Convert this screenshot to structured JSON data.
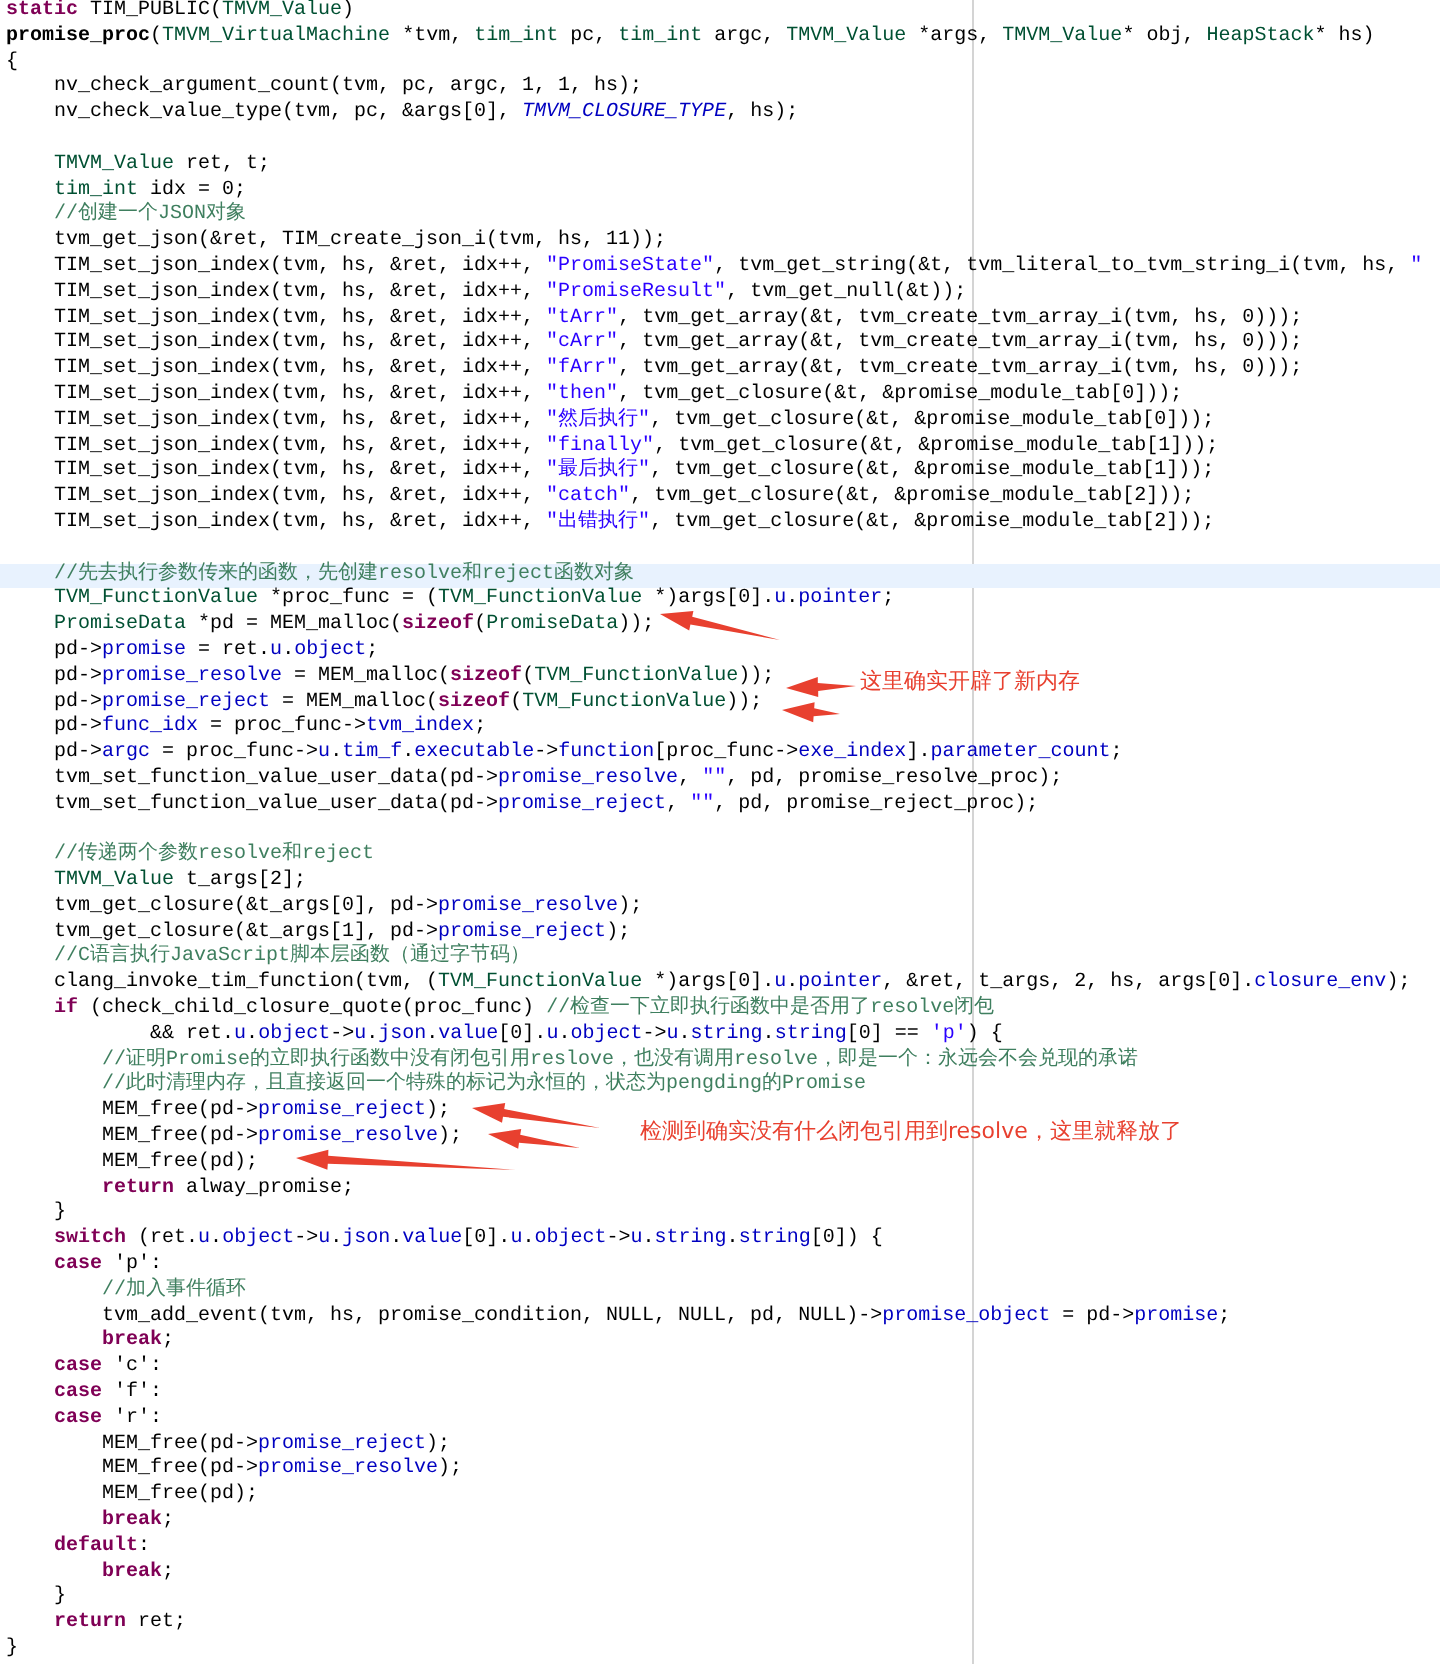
{
  "lines": [
    {
      "kind": "code",
      "current": false,
      "tokens": [
        {
          "kind": "keyword",
          "text": "static"
        },
        {
          "kind": "plain",
          "text": " TIM_PUBLIC("
        },
        {
          "kind": "type",
          "text": "TMVM_Value"
        },
        {
          "kind": "plain",
          "text": ")"
        }
      ]
    },
    {
      "kind": "code",
      "current": false,
      "tokens": [
        {
          "kind": "definition",
          "text": "promise_proc"
        },
        {
          "kind": "plain",
          "text": "("
        },
        {
          "kind": "type",
          "text": "TMVM_VirtualMachine"
        },
        {
          "kind": "plain",
          "text": " *tvm, "
        },
        {
          "kind": "type",
          "text": "tim_int"
        },
        {
          "kind": "plain",
          "text": " pc, "
        },
        {
          "kind": "type",
          "text": "tim_int"
        },
        {
          "kind": "plain",
          "text": " argc, "
        },
        {
          "kind": "type",
          "text": "TMVM_Value"
        },
        {
          "kind": "plain",
          "text": " *args, "
        },
        {
          "kind": "type",
          "text": "TMVM_Value"
        },
        {
          "kind": "plain",
          "text": "* obj, "
        },
        {
          "kind": "type",
          "text": "HeapStack"
        },
        {
          "kind": "plain",
          "text": "* hs)"
        }
      ]
    },
    {
      "kind": "code",
      "current": false,
      "tokens": [
        {
          "kind": "plain",
          "text": "{"
        }
      ]
    },
    {
      "kind": "code",
      "current": false,
      "tokens": [
        {
          "kind": "plain",
          "text": "    nv_check_argument_count(tvm, pc, argc, 1, 1, hs);"
        }
      ]
    },
    {
      "kind": "code",
      "current": false,
      "tokens": [
        {
          "kind": "plain",
          "text": "    nv_check_value_type(tvm, pc, &args[0], "
        },
        {
          "kind": "constant",
          "text": "TMVM_CLOSURE_TYPE"
        },
        {
          "kind": "plain",
          "text": ", hs);"
        }
      ]
    },
    {
      "kind": "blank",
      "current": false
    },
    {
      "kind": "code",
      "current": false,
      "tokens": [
        {
          "kind": "type",
          "text": "    TMVM_Value"
        },
        {
          "kind": "plain",
          "text": " ret, t;"
        }
      ]
    },
    {
      "kind": "code",
      "current": false,
      "tokens": [
        {
          "kind": "type",
          "text": "    tim_int"
        },
        {
          "kind": "plain",
          "text": " idx = 0;"
        }
      ]
    },
    {
      "kind": "code",
      "current": false,
      "tokens": [
        {
          "kind": "comment",
          "text": "    //创建一个JSON对象"
        }
      ]
    },
    {
      "kind": "code",
      "current": false,
      "tokens": [
        {
          "kind": "plain",
          "text": "    tvm_get_json(&ret, TIM_create_json_i(tvm, hs, 11));"
        }
      ]
    },
    {
      "kind": "code",
      "current": false,
      "tokens": [
        {
          "kind": "plain",
          "text": "    TIM_set_json_index(tvm, hs, &ret, idx++, "
        },
        {
          "kind": "string",
          "text": "\"PromiseState\""
        },
        {
          "kind": "plain",
          "text": ", tvm_get_string(&t, tvm_literal_to_tvm_string_i(tvm, hs, "
        },
        {
          "kind": "string",
          "text": "\""
        }
      ]
    },
    {
      "kind": "code",
      "current": false,
      "tokens": [
        {
          "kind": "plain",
          "text": "    TIM_set_json_index(tvm, hs, &ret, idx++, "
        },
        {
          "kind": "string",
          "text": "\"PromiseResult\""
        },
        {
          "kind": "plain",
          "text": ", tvm_get_null(&t));"
        }
      ]
    },
    {
      "kind": "code",
      "current": false,
      "tokens": [
        {
          "kind": "plain",
          "text": "    TIM_set_json_index(tvm, hs, &ret, idx++, "
        },
        {
          "kind": "string",
          "text": "\"tArr\""
        },
        {
          "kind": "plain",
          "text": ", tvm_get_array(&t, tvm_create_tvm_array_i(tvm, hs, 0)));"
        }
      ]
    },
    {
      "kind": "code",
      "current": false,
      "tokens": [
        {
          "kind": "plain",
          "text": "    TIM_set_json_index(tvm, hs, &ret, idx++, "
        },
        {
          "kind": "string",
          "text": "\"cArr\""
        },
        {
          "kind": "plain",
          "text": ", tvm_get_array(&t, tvm_create_tvm_array_i(tvm, hs, 0)));"
        }
      ]
    },
    {
      "kind": "code",
      "current": false,
      "tokens": [
        {
          "kind": "plain",
          "text": "    TIM_set_json_index(tvm, hs, &ret, idx++, "
        },
        {
          "kind": "string",
          "text": "\"fArr\""
        },
        {
          "kind": "plain",
          "text": ", tvm_get_array(&t, tvm_create_tvm_array_i(tvm, hs, 0)));"
        }
      ]
    },
    {
      "kind": "code",
      "current": false,
      "tokens": [
        {
          "kind": "plain",
          "text": "    TIM_set_json_index(tvm, hs, &ret, idx++, "
        },
        {
          "kind": "string",
          "text": "\"then\""
        },
        {
          "kind": "plain",
          "text": ", tvm_get_closure(&t, &promise_module_tab[0]));"
        }
      ]
    },
    {
      "kind": "code",
      "current": false,
      "tokens": [
        {
          "kind": "plain",
          "text": "    TIM_set_json_index(tvm, hs, &ret, idx++, "
        },
        {
          "kind": "string",
          "text": "\"然后执行\""
        },
        {
          "kind": "plain",
          "text": ", tvm_get_closure(&t, &promise_module_tab[0]));"
        }
      ]
    },
    {
      "kind": "code",
      "current": false,
      "tokens": [
        {
          "kind": "plain",
          "text": "    TIM_set_json_index(tvm, hs, &ret, idx++, "
        },
        {
          "kind": "string",
          "text": "\"finally\""
        },
        {
          "kind": "plain",
          "text": ", tvm_get_closure(&t, &promise_module_tab[1]));"
        }
      ]
    },
    {
      "kind": "code",
      "current": false,
      "tokens": [
        {
          "kind": "plain",
          "text": "    TIM_set_json_index(tvm, hs, &ret, idx++, "
        },
        {
          "kind": "string",
          "text": "\"最后执行\""
        },
        {
          "kind": "plain",
          "text": ", tvm_get_closure(&t, &promise_module_tab[1]));"
        }
      ]
    },
    {
      "kind": "code",
      "current": false,
      "tokens": [
        {
          "kind": "plain",
          "text": "    TIM_set_json_index(tvm, hs, &ret, idx++, "
        },
        {
          "kind": "string",
          "text": "\"catch\""
        },
        {
          "kind": "plain",
          "text": ", tvm_get_closure(&t, &promise_module_tab[2]));"
        }
      ]
    },
    {
      "kind": "code",
      "current": false,
      "tokens": [
        {
          "kind": "plain",
          "text": "    TIM_set_json_index(tvm, hs, &ret, idx++, "
        },
        {
          "kind": "string",
          "text": "\"出错执行\""
        },
        {
          "kind": "plain",
          "text": ", tvm_get_closure(&t, &promise_module_tab[2]));"
        }
      ]
    },
    {
      "kind": "blank",
      "current": false
    },
    {
      "kind": "code",
      "current": true,
      "tokens": [
        {
          "kind": "comment",
          "text": "    //先去执行参数传来的函数，先创建resolve和reject函数对象"
        }
      ]
    },
    {
      "kind": "code",
      "current": false,
      "tokens": [
        {
          "kind": "type",
          "text": "    TVM_FunctionValue"
        },
        {
          "kind": "plain",
          "text": " *proc_func = ("
        },
        {
          "kind": "type",
          "text": "TVM_FunctionValue"
        },
        {
          "kind": "plain",
          "text": " *)args[0]."
        },
        {
          "kind": "field",
          "text": "u"
        },
        {
          "kind": "plain",
          "text": "."
        },
        {
          "kind": "field",
          "text": "pointer"
        },
        {
          "kind": "plain",
          "text": ";"
        }
      ]
    },
    {
      "kind": "code",
      "current": false,
      "tokens": [
        {
          "kind": "type",
          "text": "    PromiseData"
        },
        {
          "kind": "plain",
          "text": " *pd = MEM_malloc("
        },
        {
          "kind": "keyword",
          "text": "sizeof"
        },
        {
          "kind": "plain",
          "text": "("
        },
        {
          "kind": "type",
          "text": "PromiseData"
        },
        {
          "kind": "plain",
          "text": "));"
        }
      ]
    },
    {
      "kind": "code",
      "current": false,
      "tokens": [
        {
          "kind": "plain",
          "text": "    pd->"
        },
        {
          "kind": "field",
          "text": "promise"
        },
        {
          "kind": "plain",
          "text": " = ret."
        },
        {
          "kind": "field",
          "text": "u"
        },
        {
          "kind": "plain",
          "text": "."
        },
        {
          "kind": "field",
          "text": "object"
        },
        {
          "kind": "plain",
          "text": ";"
        }
      ]
    },
    {
      "kind": "code",
      "current": false,
      "tokens": [
        {
          "kind": "plain",
          "text": "    pd->"
        },
        {
          "kind": "field",
          "text": "promise_resolve"
        },
        {
          "kind": "plain",
          "text": " = MEM_malloc("
        },
        {
          "kind": "keyword",
          "text": "sizeof"
        },
        {
          "kind": "plain",
          "text": "("
        },
        {
          "kind": "type",
          "text": "TVM_FunctionValue"
        },
        {
          "kind": "plain",
          "text": "));"
        }
      ]
    },
    {
      "kind": "code",
      "current": false,
      "tokens": [
        {
          "kind": "plain",
          "text": "    pd->"
        },
        {
          "kind": "field",
          "text": "promise_reject"
        },
        {
          "kind": "plain",
          "text": " = MEM_malloc("
        },
        {
          "kind": "keyword",
          "text": "sizeof"
        },
        {
          "kind": "plain",
          "text": "("
        },
        {
          "kind": "type",
          "text": "TVM_FunctionValue"
        },
        {
          "kind": "plain",
          "text": "));"
        }
      ]
    },
    {
      "kind": "code",
      "current": false,
      "tokens": [
        {
          "kind": "plain",
          "text": "    pd->"
        },
        {
          "kind": "field",
          "text": "func_idx"
        },
        {
          "kind": "plain",
          "text": " = proc_func->"
        },
        {
          "kind": "field",
          "text": "tvm_index"
        },
        {
          "kind": "plain",
          "text": ";"
        }
      ]
    },
    {
      "kind": "code",
      "current": false,
      "tokens": [
        {
          "kind": "plain",
          "text": "    pd->"
        },
        {
          "kind": "field",
          "text": "argc"
        },
        {
          "kind": "plain",
          "text": " = proc_func->"
        },
        {
          "kind": "field",
          "text": "u"
        },
        {
          "kind": "plain",
          "text": "."
        },
        {
          "kind": "field",
          "text": "tim_f"
        },
        {
          "kind": "plain",
          "text": "."
        },
        {
          "kind": "field",
          "text": "executable"
        },
        {
          "kind": "plain",
          "text": "->"
        },
        {
          "kind": "field",
          "text": "function"
        },
        {
          "kind": "plain",
          "text": "[proc_func->"
        },
        {
          "kind": "field",
          "text": "exe_index"
        },
        {
          "kind": "plain",
          "text": "]."
        },
        {
          "kind": "field",
          "text": "parameter_count"
        },
        {
          "kind": "plain",
          "text": ";"
        }
      ]
    },
    {
      "kind": "code",
      "current": false,
      "tokens": [
        {
          "kind": "plain",
          "text": "    tvm_set_function_value_user_data(pd->"
        },
        {
          "kind": "field",
          "text": "promise_resolve"
        },
        {
          "kind": "plain",
          "text": ", "
        },
        {
          "kind": "string",
          "text": "\"\""
        },
        {
          "kind": "plain",
          "text": ", pd, promise_resolve_proc);"
        }
      ]
    },
    {
      "kind": "code",
      "current": false,
      "tokens": [
        {
          "kind": "plain",
          "text": "    tvm_set_function_value_user_data(pd->"
        },
        {
          "kind": "field",
          "text": "promise_reject"
        },
        {
          "kind": "plain",
          "text": ", "
        },
        {
          "kind": "string",
          "text": "\"\""
        },
        {
          "kind": "plain",
          "text": ", pd, promise_reject_proc);"
        }
      ]
    },
    {
      "kind": "blank",
      "current": false
    },
    {
      "kind": "code",
      "current": false,
      "tokens": [
        {
          "kind": "comment",
          "text": "    //传递两个参数resolve和reject"
        }
      ]
    },
    {
      "kind": "code",
      "current": false,
      "tokens": [
        {
          "kind": "type",
          "text": "    TMVM_Value"
        },
        {
          "kind": "plain",
          "text": " t_args[2];"
        }
      ]
    },
    {
      "kind": "code",
      "current": false,
      "tokens": [
        {
          "kind": "plain",
          "text": "    tvm_get_closure(&t_args[0], pd->"
        },
        {
          "kind": "field",
          "text": "promise_resolve"
        },
        {
          "kind": "plain",
          "text": ");"
        }
      ]
    },
    {
      "kind": "code",
      "current": false,
      "tokens": [
        {
          "kind": "plain",
          "text": "    tvm_get_closure(&t_args[1], pd->"
        },
        {
          "kind": "field",
          "text": "promise_reject"
        },
        {
          "kind": "plain",
          "text": ");"
        }
      ]
    },
    {
      "kind": "code",
      "current": false,
      "tokens": [
        {
          "kind": "comment",
          "text": "    //C语言执行JavaScript脚本层函数（通过字节码）"
        }
      ]
    },
    {
      "kind": "code",
      "current": false,
      "tokens": [
        {
          "kind": "plain",
          "text": "    clang_invoke_tim_function(tvm, ("
        },
        {
          "kind": "type",
          "text": "TVM_FunctionValue"
        },
        {
          "kind": "plain",
          "text": " *)args[0]."
        },
        {
          "kind": "field",
          "text": "u"
        },
        {
          "kind": "plain",
          "text": "."
        },
        {
          "kind": "field",
          "text": "pointer"
        },
        {
          "kind": "plain",
          "text": ", &ret, t_args, 2, hs, args[0]."
        },
        {
          "kind": "field",
          "text": "closure_env"
        },
        {
          "kind": "plain",
          "text": ");"
        }
      ]
    },
    {
      "kind": "code",
      "current": false,
      "tokens": [
        {
          "kind": "keyword",
          "text": "    if"
        },
        {
          "kind": "plain",
          "text": " (check_child_closure_quote(proc_func) "
        },
        {
          "kind": "comment",
          "text": "//检查一下立即执行函数中是否用了resolve闭包"
        }
      ]
    },
    {
      "kind": "code",
      "current": false,
      "tokens": [
        {
          "kind": "plain",
          "text": "            && ret."
        },
        {
          "kind": "field",
          "text": "u"
        },
        {
          "kind": "plain",
          "text": "."
        },
        {
          "kind": "field",
          "text": "object"
        },
        {
          "kind": "plain",
          "text": "->"
        },
        {
          "kind": "field",
          "text": "u"
        },
        {
          "kind": "plain",
          "text": "."
        },
        {
          "kind": "field",
          "text": "json"
        },
        {
          "kind": "plain",
          "text": "."
        },
        {
          "kind": "field",
          "text": "value"
        },
        {
          "kind": "plain",
          "text": "[0]."
        },
        {
          "kind": "field",
          "text": "u"
        },
        {
          "kind": "plain",
          "text": "."
        },
        {
          "kind": "field",
          "text": "object"
        },
        {
          "kind": "plain",
          "text": "->"
        },
        {
          "kind": "field",
          "text": "u"
        },
        {
          "kind": "plain",
          "text": "."
        },
        {
          "kind": "field",
          "text": "string"
        },
        {
          "kind": "plain",
          "text": "."
        },
        {
          "kind": "field",
          "text": "string"
        },
        {
          "kind": "plain",
          "text": "[0] == "
        },
        {
          "kind": "string",
          "text": "'p'"
        },
        {
          "kind": "plain",
          "text": ") {"
        }
      ]
    },
    {
      "kind": "code",
      "current": false,
      "tokens": [
        {
          "kind": "comment",
          "text": "        //证明Promise的立即执行函数中没有闭包引用reslove，也没有调用resolve，即是一个：永远会不会兑现的承诺"
        }
      ]
    },
    {
      "kind": "code",
      "current": false,
      "tokens": [
        {
          "kind": "comment",
          "text": "        //此时清理内存，且直接返回一个特殊的标记为永恒的，状态为pengding的Promise"
        }
      ]
    },
    {
      "kind": "code",
      "current": false,
      "tokens": [
        {
          "kind": "plain",
          "text": "        MEM_free(pd->"
        },
        {
          "kind": "field",
          "text": "promise_reject"
        },
        {
          "kind": "plain",
          "text": ");"
        }
      ]
    },
    {
      "kind": "code",
      "current": false,
      "tokens": [
        {
          "kind": "plain",
          "text": "        MEM_free(pd->"
        },
        {
          "kind": "field",
          "text": "promise_resolve"
        },
        {
          "kind": "plain",
          "text": ");"
        }
      ]
    },
    {
      "kind": "code",
      "current": false,
      "tokens": [
        {
          "kind": "plain",
          "text": "        MEM_free(pd);"
        }
      ]
    },
    {
      "kind": "code",
      "current": false,
      "tokens": [
        {
          "kind": "keyword",
          "text": "        return"
        },
        {
          "kind": "plain",
          "text": " alway_promise;"
        }
      ]
    },
    {
      "kind": "code",
      "current": false,
      "tokens": [
        {
          "kind": "plain",
          "text": "    }"
        }
      ]
    },
    {
      "kind": "code",
      "current": false,
      "tokens": [
        {
          "kind": "keyword",
          "text": "    switch"
        },
        {
          "kind": "plain",
          "text": " (ret."
        },
        {
          "kind": "field",
          "text": "u"
        },
        {
          "kind": "plain",
          "text": "."
        },
        {
          "kind": "field",
          "text": "object"
        },
        {
          "kind": "plain",
          "text": "->"
        },
        {
          "kind": "field",
          "text": "u"
        },
        {
          "kind": "plain",
          "text": "."
        },
        {
          "kind": "field",
          "text": "json"
        },
        {
          "kind": "plain",
          "text": "."
        },
        {
          "kind": "field",
          "text": "value"
        },
        {
          "kind": "plain",
          "text": "[0]."
        },
        {
          "kind": "field",
          "text": "u"
        },
        {
          "kind": "plain",
          "text": "."
        },
        {
          "kind": "field",
          "text": "object"
        },
        {
          "kind": "plain",
          "text": "->"
        },
        {
          "kind": "field",
          "text": "u"
        },
        {
          "kind": "plain",
          "text": "."
        },
        {
          "kind": "field",
          "text": "string"
        },
        {
          "kind": "plain",
          "text": "."
        },
        {
          "kind": "field",
          "text": "string"
        },
        {
          "kind": "plain",
          "text": "[0]) {"
        }
      ]
    },
    {
      "kind": "code",
      "current": false,
      "tokens": [
        {
          "kind": "keyword",
          "text": "    case"
        },
        {
          "kind": "plain",
          "text": " 'p':"
        }
      ]
    },
    {
      "kind": "code",
      "current": false,
      "tokens": [
        {
          "kind": "comment",
          "text": "        //加入事件循环"
        }
      ]
    },
    {
      "kind": "code",
      "current": false,
      "tokens": [
        {
          "kind": "plain",
          "text": "        tvm_add_event(tvm, hs, promise_condition, NULL, NULL, pd, NULL)->"
        },
        {
          "kind": "field",
          "text": "promise_object"
        },
        {
          "kind": "plain",
          "text": " = pd->"
        },
        {
          "kind": "field",
          "text": "promise"
        },
        {
          "kind": "plain",
          "text": ";"
        }
      ]
    },
    {
      "kind": "code",
      "current": false,
      "tokens": [
        {
          "kind": "keyword",
          "text": "        break"
        },
        {
          "kind": "plain",
          "text": ";"
        }
      ]
    },
    {
      "kind": "code",
      "current": false,
      "tokens": [
        {
          "kind": "keyword",
          "text": "    case"
        },
        {
          "kind": "plain",
          "text": " 'c':"
        }
      ]
    },
    {
      "kind": "code",
      "current": false,
      "tokens": [
        {
          "kind": "keyword",
          "text": "    case"
        },
        {
          "kind": "plain",
          "text": " 'f':"
        }
      ]
    },
    {
      "kind": "code",
      "current": false,
      "tokens": [
        {
          "kind": "keyword",
          "text": "    case"
        },
        {
          "kind": "plain",
          "text": " 'r':"
        }
      ]
    },
    {
      "kind": "code",
      "current": false,
      "tokens": [
        {
          "kind": "plain",
          "text": "        MEM_free(pd->"
        },
        {
          "kind": "field",
          "text": "promise_reject"
        },
        {
          "kind": "plain",
          "text": ");"
        }
      ]
    },
    {
      "kind": "code",
      "current": false,
      "tokens": [
        {
          "kind": "plain",
          "text": "        MEM_free(pd->"
        },
        {
          "kind": "field",
          "text": "promise_resolve"
        },
        {
          "kind": "plain",
          "text": ");"
        }
      ]
    },
    {
      "kind": "code",
      "current": false,
      "tokens": [
        {
          "kind": "plain",
          "text": "        MEM_free(pd);"
        }
      ]
    },
    {
      "kind": "code",
      "current": false,
      "tokens": [
        {
          "kind": "keyword",
          "text": "        break"
        },
        {
          "kind": "plain",
          "text": ";"
        }
      ]
    },
    {
      "kind": "code",
      "current": false,
      "tokens": [
        {
          "kind": "keyword",
          "text": "    default"
        },
        {
          "kind": "plain",
          "text": ":"
        }
      ]
    },
    {
      "kind": "code",
      "current": false,
      "tokens": [
        {
          "kind": "keyword",
          "text": "        break"
        },
        {
          "kind": "plain",
          "text": ";"
        }
      ]
    },
    {
      "kind": "code",
      "current": false,
      "tokens": [
        {
          "kind": "plain",
          "text": "    }"
        }
      ]
    },
    {
      "kind": "code",
      "current": false,
      "tokens": [
        {
          "kind": "keyword",
          "text": "    return"
        },
        {
          "kind": "plain",
          "text": " ret;"
        }
      ]
    },
    {
      "kind": "code",
      "current": false,
      "tokens": [
        {
          "kind": "plain",
          "text": "}"
        }
      ]
    }
  ],
  "annotations": [
    {
      "text": "这里确实开辟了新内存"
    },
    {
      "text": "检测到确实没有什么闭包引用到resolve，这里就释放了"
    }
  ]
}
